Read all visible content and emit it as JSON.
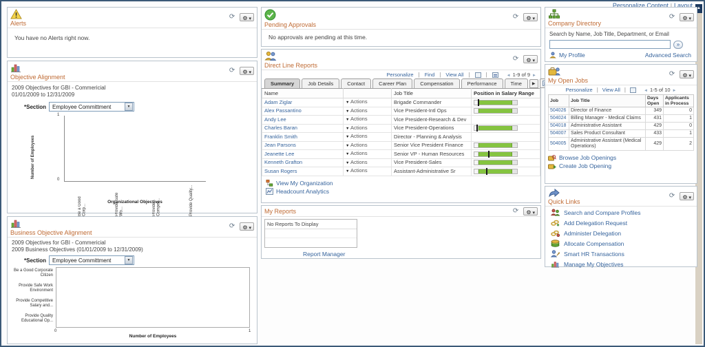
{
  "page": {
    "personalize_content": "Personalize Content",
    "layout": "Layout"
  },
  "alerts": {
    "title": "Alerts",
    "message": "You have no Alerts right now."
  },
  "objective_alignment": {
    "title": "Objective Alignment",
    "subtitle1": "2009 Objectives for GBI - Commericial",
    "subtitle2": "01/01/2009 to 12/31/2009",
    "section_label": "*Section",
    "section_value": "Employee Committment"
  },
  "business_objective_alignment": {
    "title": "Business Objective Alignment",
    "subtitle1": "2009 Objectives for GBI - Commericial",
    "subtitle2": "2009 Business Objectives  (01/01/2009  to  12/31/2009)",
    "section_label": "*Section",
    "section_value": "Employee Committment"
  },
  "pending_approvals": {
    "title": "Pending Approvals",
    "message": "No approvals are pending at this time."
  },
  "direct_line_reports": {
    "title": "Direct Line Reports",
    "toolbar": {
      "personalize": "Personalize",
      "find": "Find",
      "view_all": "View All",
      "pagination": "1-9 of 9"
    },
    "tabs": [
      "Summary",
      "Job Details",
      "Contact",
      "Career Plan",
      "Compensation",
      "Performance",
      "Time"
    ],
    "columns": {
      "name": "Name",
      "job_title": "Job Title",
      "salary_range": "Position in Salary Range"
    },
    "actions_label": "Actions",
    "rows": [
      {
        "name": "Adam Ziglar",
        "job_title": "Brigade Commander",
        "has_salary_bar": true,
        "salary_marker_pct": 8
      },
      {
        "name": "Alex Passantino",
        "job_title": "Vice President-Intl Ops",
        "has_salary_bar": true,
        "salary_marker_pct": null
      },
      {
        "name": "Andy Lee",
        "job_title": "Vice President-Research & Dev",
        "has_salary_bar": false,
        "salary_marker_pct": null
      },
      {
        "name": "Charles Baran",
        "job_title": "Vice President-Operations",
        "has_salary_bar": true,
        "salary_marker_pct": 5
      },
      {
        "name": "Franklin Smith",
        "job_title": "Director - Planning & Analysis",
        "has_salary_bar": false,
        "salary_marker_pct": null
      },
      {
        "name": "Jean Parsons",
        "job_title": "Senior Vice President Finance",
        "has_salary_bar": true,
        "salary_marker_pct": null
      },
      {
        "name": "Jeanette Lee",
        "job_title": "Senior VP - Human Resources",
        "has_salary_bar": true,
        "salary_marker_pct": 32
      },
      {
        "name": "Kenneth Grafton",
        "job_title": "Vice President-Sales",
        "has_salary_bar": true,
        "salary_marker_pct": null
      },
      {
        "name": "Susan Rogers",
        "job_title": "Assistant-Administrative Sr",
        "has_salary_bar": true,
        "salary_marker_pct": 27
      }
    ],
    "links": {
      "view_my_organization": "View My Organization",
      "headcount_analytics": "Headcount Analytics"
    }
  },
  "my_reports": {
    "title": "My Reports",
    "empty_message": "No Reports To Display",
    "report_manager": "Report Manager"
  },
  "company_directory": {
    "title": "Company Directory",
    "search_hint": "Search by Name, Job Title, Department, or Email",
    "go_button": "»",
    "my_profile": "My Profile",
    "advanced_search": "Advanced Search"
  },
  "my_open_jobs": {
    "title": "My Open Jobs",
    "toolbar": {
      "personalize": "Personalize",
      "view_all": "View All",
      "pagination": "1-5 of 10"
    },
    "columns": {
      "job": "Job",
      "job_title": "Job Title",
      "days_open": "Days Open",
      "applicants": "Applicants in Process"
    },
    "rows": [
      {
        "job": "504026",
        "job_title": "Director of Finance",
        "days_open": "349",
        "applicants": "0"
      },
      {
        "job": "504024",
        "job_title": "Billing Manager - Medical Claims",
        "days_open": "431",
        "applicants": "1"
      },
      {
        "job": "504018",
        "job_title": "Administrative Assistant",
        "days_open": "429",
        "applicants": "0"
      },
      {
        "job": "504007",
        "job_title": "Sales Product Consultant",
        "days_open": "433",
        "applicants": "1"
      },
      {
        "job": "504005",
        "job_title": "Administrative Assistant (Medical Operations)",
        "days_open": "429",
        "applicants": "2"
      }
    ],
    "links": {
      "browse": "Browse Job Openings",
      "create": "Create Job Opening"
    }
  },
  "quick_links": {
    "title": "Quick Links",
    "items": [
      {
        "label": "Search and Compare Profiles",
        "icon": "people-search-icon"
      },
      {
        "label": "Add Delegation Request",
        "icon": "link-add-icon"
      },
      {
        "label": "Administer Delegation",
        "icon": "link-admin-icon"
      },
      {
        "label": "Allocate Compensation",
        "icon": "money-icon"
      },
      {
        "label": "Smart HR Transactions",
        "icon": "person-edit-icon"
      },
      {
        "label": "Manage My Objectives",
        "icon": "bar-chart-icon"
      }
    ]
  },
  "chart_data": [
    {
      "type": "bar",
      "panel": "Objective Alignment",
      "title": "2009 Objectives for GBI - Commericial",
      "categories": [
        "Be a Good Corp...",
        "Provide Safe Wo...",
        "Provide Compet...",
        "Provide Quality..."
      ],
      "values": [
        0,
        0,
        0,
        0
      ],
      "xlabel": "Organizational Objectives",
      "ylabel": "Number of Employees",
      "ylim": [
        0,
        1
      ],
      "yticks": [
        "1",
        "0"
      ],
      "grid": false
    },
    {
      "type": "bar",
      "orientation": "horizontal",
      "panel": "Business Objective Alignment",
      "title": "2009 Business Objectives (01/01/2009 to 12/31/2009)",
      "categories": [
        "Be a Good Corporate Citizen",
        "Provide Safe Work Environment",
        "Provide Competitive Salary and...",
        "Provide Quality Educational Op..."
      ],
      "values": [
        0,
        0,
        0,
        0
      ],
      "xlabel": "Number of Employees",
      "xlim": [
        0,
        1
      ],
      "xticks": [
        "0",
        "1"
      ],
      "grid": false
    }
  ]
}
